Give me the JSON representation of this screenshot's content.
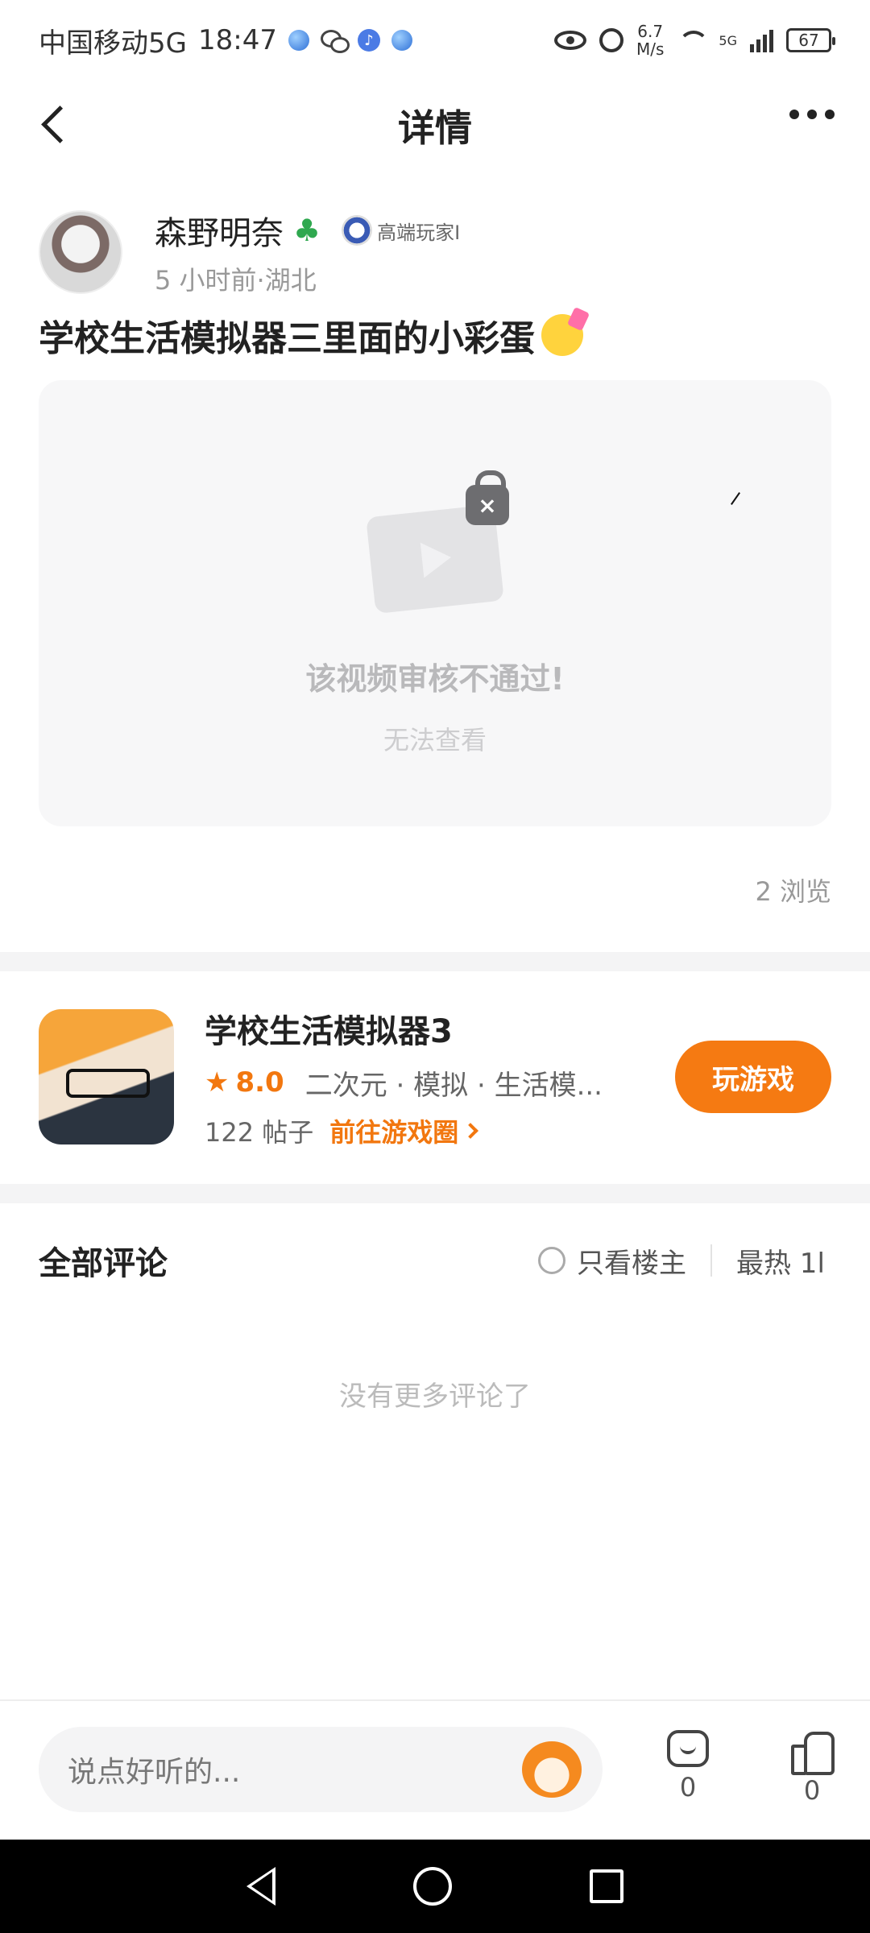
{
  "status_bar": {
    "carrier": "中国移动5G",
    "time": "18:47",
    "speed_value": "6.7",
    "speed_unit": "M/s",
    "network": "5G",
    "battery": "67"
  },
  "header": {
    "title": "详情"
  },
  "post": {
    "author_name": "森野明奈",
    "badge_label": "高端玩家I",
    "meta": "5 小时前·湖北",
    "title": "学校生活模拟器三里面的小彩蛋",
    "video_message": "该视频审核不通过!",
    "video_submessage": "无法查看",
    "views": "2 浏览"
  },
  "game": {
    "title": "学校生活模拟器3",
    "rating": "8.0",
    "tags": "二次元 · 模拟 · 生活模...",
    "posts": "122 帖子",
    "goto_circle": "前往游戏圈",
    "play_label": "玩游戏"
  },
  "comments": {
    "title": "全部评论",
    "only_op": "只看楼主",
    "sort": "最热 1l",
    "empty": "没有更多评论了"
  },
  "bottom_bar": {
    "input_placeholder": "说点好听的...",
    "comment_count": "0",
    "like_count": "0"
  },
  "colors": {
    "accent": "#f57a12",
    "background": "#ffffff",
    "divider": "#f4f4f5"
  }
}
